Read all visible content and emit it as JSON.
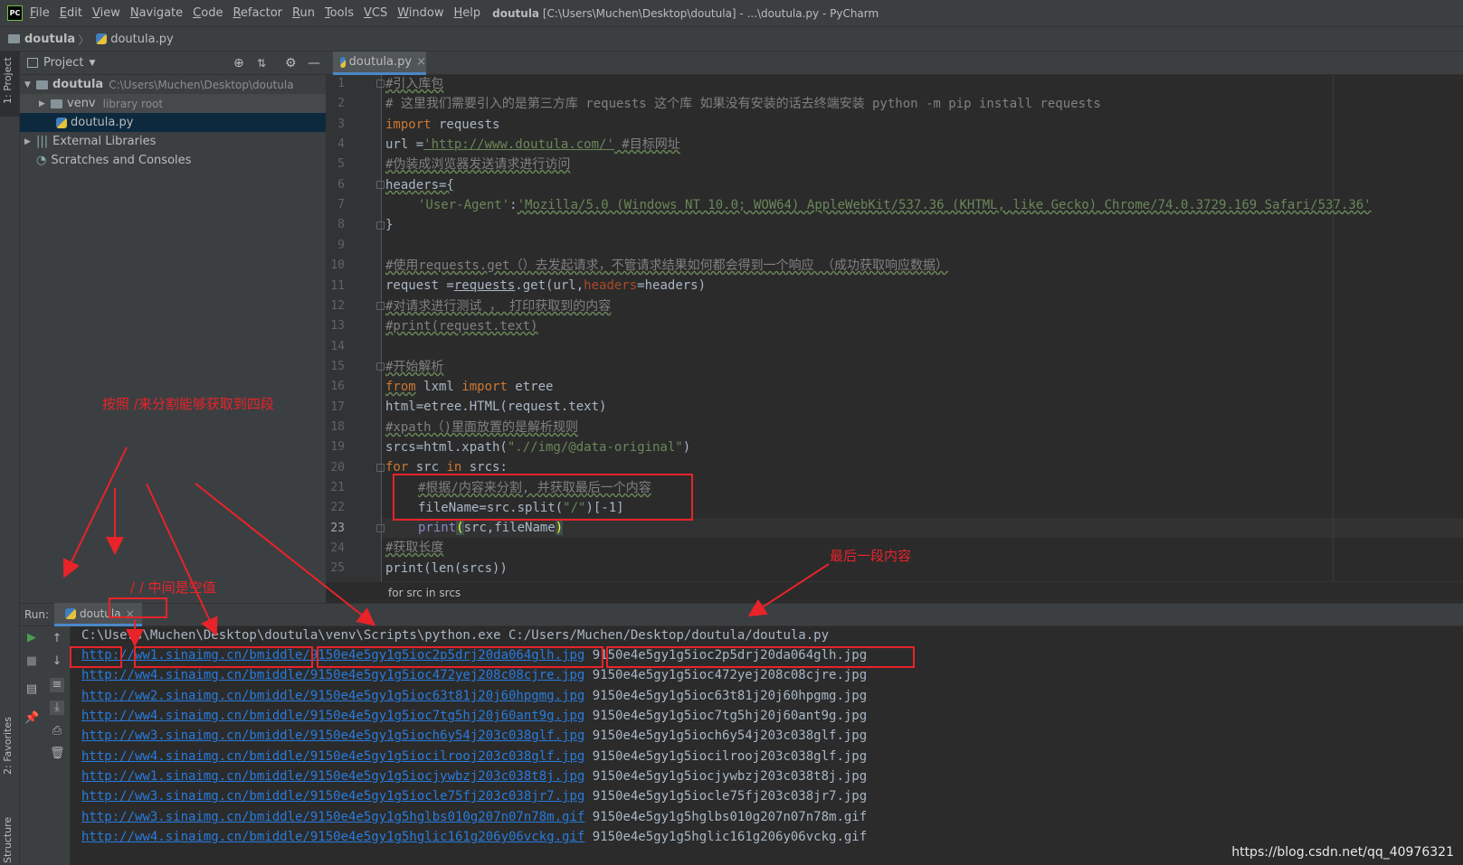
{
  "menubar": {
    "logo": "PC",
    "items": [
      {
        "label": "File",
        "ul": "F",
        "rest": "ile"
      },
      {
        "label": "Edit",
        "ul": "E",
        "rest": "dit"
      },
      {
        "label": "View",
        "ul": "V",
        "rest": "iew"
      },
      {
        "label": "Navigate",
        "ul": "N",
        "rest": "avigate"
      },
      {
        "label": "Code",
        "ul": "C",
        "rest": "ode"
      },
      {
        "label": "Refactor",
        "ul": "R",
        "rest": "efactor"
      },
      {
        "label": "Run",
        "ul": "R",
        "rest": "un"
      },
      {
        "label": "Tools",
        "ul": "T",
        "rest": "ools"
      },
      {
        "label": "VCS",
        "ul": "V",
        "rest": "CS"
      },
      {
        "label": "Window",
        "ul": "W",
        "rest": "indow"
      },
      {
        "label": "Help",
        "ul": "H",
        "rest": "elp"
      }
    ],
    "title_bold": "doutula",
    "title_rest": " [C:\\Users\\Muchen\\Desktop\\doutula] - ...\\doutula.py - PyCharm"
  },
  "navbar": {
    "project": "doutula",
    "file": "doutula.py"
  },
  "leftstrip": {
    "project_tab": "1: Project",
    "favorites_tab": "2: Favorites",
    "structure_tab": "Structure"
  },
  "project_panel": {
    "header": "Project",
    "root_name": "doutula",
    "root_path": "C:\\Users\\Muchen\\Desktop\\doutula",
    "venv": "venv",
    "venv_note": "library root",
    "file": "doutula.py",
    "external": "External Libraries",
    "scratches": "Scratches and Consoles"
  },
  "editor_tab": {
    "label": "doutula.py",
    "close": "×"
  },
  "breadcrumb": "for src in srcs",
  "run": {
    "label": "Run:",
    "tab": "doutula",
    "command": "C:\\Users\\Muchen\\Desktop\\doutula\\venv\\Scripts\\python.exe C:/Users/Muchen/Desktop/doutula/doutula.py",
    "rows": [
      {
        "url": "http://ww1.sinaimg.cn/bmiddle/9150e4e5gy1g5ioc2p5drj20da064glh.jpg",
        "name": "9150e4e5gy1g5ioc2p5drj20da064glh.jpg"
      },
      {
        "url": "http://ww4.sinaimg.cn/bmiddle/9150e4e5gy1g5ioc472yej208c08cjre.jpg",
        "name": "9150e4e5gy1g5ioc472yej208c08cjre.jpg"
      },
      {
        "url": "http://ww2.sinaimg.cn/bmiddle/9150e4e5gy1g5ioc63t81j20j60hpgmg.jpg",
        "name": "9150e4e5gy1g5ioc63t81j20j60hpgmg.jpg"
      },
      {
        "url": "http://ww4.sinaimg.cn/bmiddle/9150e4e5gy1g5ioc7tg5hj20j60ant9g.jpg",
        "name": "9150e4e5gy1g5ioc7tg5hj20j60ant9g.jpg"
      },
      {
        "url": "http://ww3.sinaimg.cn/bmiddle/9150e4e5gy1g5ioch6y54j203c038glf.jpg",
        "name": "9150e4e5gy1g5ioch6y54j203c038glf.jpg"
      },
      {
        "url": "http://ww4.sinaimg.cn/bmiddle/9150e4e5gy1g5iocilrooj203c038glf.jpg",
        "name": "9150e4e5gy1g5iocilrooj203c038glf.jpg"
      },
      {
        "url": "http://ww1.sinaimg.cn/bmiddle/9150e4e5gy1g5iocjywbzj203c038t8j.jpg",
        "name": "9150e4e5gy1g5iocjywbzj203c038t8j.jpg"
      },
      {
        "url": "http://ww3.sinaimg.cn/bmiddle/9150e4e5gy1g5iocle75fj203c038jr7.jpg",
        "name": "9150e4e5gy1g5iocle75fj203c038jr7.jpg"
      },
      {
        "url": "http://ww3.sinaimg.cn/bmiddle/9150e4e5gy1g5hglbs010g207n07n78m.gif",
        "name": "9150e4e5gy1g5hglbs010g207n07n78m.gif"
      },
      {
        "url": "http://ww4.sinaimg.cn/bmiddle/9150e4e5gy1g5hglic161g206y06vckg.gif",
        "name": "9150e4e5gy1g5hglic161g206y06vckg.gif"
      }
    ]
  },
  "code": {
    "line_numbers": [
      "1",
      "2",
      "3",
      "4",
      "5",
      "6",
      "7",
      "8",
      "9",
      "10",
      "11",
      "12",
      "13",
      "14",
      "15",
      "16",
      "17",
      "18",
      "19",
      "20",
      "21",
      "22",
      "23",
      "24",
      "25"
    ],
    "l1": "#引入库包",
    "l2": "# 这里我们需要引入的是第三方库 requests 这个库 如果没有安装的话去终端安装 python -m pip install requests",
    "l3_kw": "import",
    "l3_rest": " requests",
    "l4_a": "url =",
    "l4_str": "'http://www.doutula.com/'",
    "l4_cm": " #目标网址",
    "l5": "#伪装成浏览器发送请求进行访问",
    "l6": "headers={",
    "l7_key": "'User-Agent'",
    "l7_colon": ":",
    "l7_val": "'Mozilla/5.0 (Windows NT 10.0; WOW64) AppleWebKit/537.36 (KHTML, like Gecko) Chrome/74.0.3729.169 Safari/537.36'",
    "l8": "}",
    "l10": "#使用requests.get（）去发起请求，不管请求结果如何都会得到一个响应 （成功获取响应数据）",
    "l11_a": "request =",
    "l11_b": "requests",
    "l11_c": ".get(url,",
    "l11_par": "headers",
    "l11_d": "=headers)",
    "l12": "#对请求进行测试 ， 打印获取到的内容",
    "l13": "#print(request.text)",
    "l15": "#开始解析",
    "l16_kw1": "from",
    "l16_mid": " lxml ",
    "l16_kw2": "import",
    "l16_rest": " etree",
    "l17": "html=etree.HTML(request.text)",
    "l18": "#xpath（)里面放置的是解析规则",
    "l19_a": "srcs=html.xpath(",
    "l19_str": "\".//img/@data-original\"",
    "l19_b": ")",
    "l20_kw1": "for",
    "l20_mid": " src ",
    "l20_kw2": "in",
    "l20_rest": " srcs:",
    "l21": "#根据/内容来分割, 并获取最后一个内容",
    "l22_a": "fileName=src.split(",
    "l22_str": "\"/\"",
    "l22_b": ")[-1]",
    "l23_kw": "print",
    "l23_a": "(",
    "l23_b": "src,fileName",
    "l23_c": ")",
    "l24": "#获取长度",
    "l25": "print(len(srcs))"
  },
  "annotations": {
    "split_note": "按照  /来分割能够获取到四段",
    "empty_note": "/ / 中间是空值",
    "last_note": "最后一段内容"
  },
  "watermark": "https://blog.csdn.net/qq_40976321"
}
